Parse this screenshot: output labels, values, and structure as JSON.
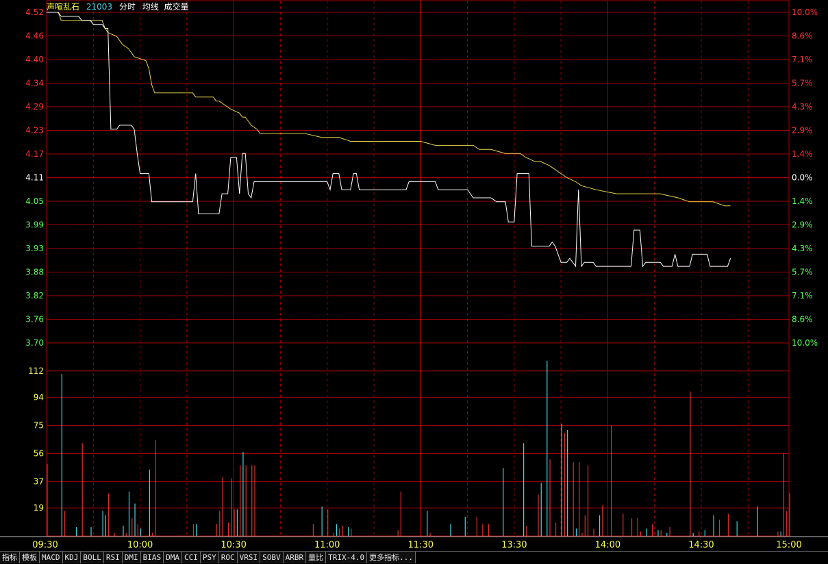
{
  "header": {
    "name": "声喧乱石",
    "code": "21003",
    "labels": [
      "分时",
      "均线",
      "成交量"
    ]
  },
  "colors": {
    "up": "#ff3232",
    "down": "#54ff54",
    "flat": "#ffffff",
    "grid": "#a00000",
    "price_line": "#ffffff",
    "avg_line": "#e8d34a",
    "vol_up": "#e03030",
    "vol_down": "#40d8e8",
    "vol_axis": "#ffff50",
    "header_name": "#ffff50",
    "header_code": "#40d8e8"
  },
  "tabs": [
    "指标",
    "模板",
    "MACD",
    "KDJ",
    "BOLL",
    "RSI",
    "DMI",
    "BIAS",
    "DMA",
    "CCI",
    "PSY",
    "ROC",
    "VRSI",
    "SOBV",
    "ARBR",
    "量比",
    "TRIX-4.0",
    "更多指标..."
  ],
  "chart_data": {
    "type": "line",
    "x_labels": [
      "09:30",
      "10:00",
      "10:30",
      "11:00",
      "11:30",
      "13:30",
      "14:00",
      "14:30",
      "15:00"
    ],
    "price_ticks": [
      "4.52",
      "4.46",
      "4.40",
      "4.34",
      "4.29",
      "4.23",
      "4.17",
      "4.11",
      "4.05",
      "3.99",
      "3.93",
      "3.88",
      "3.82",
      "3.76",
      "3.70"
    ],
    "pct_ticks": [
      "10.0%",
      "8.6%",
      "7.1%",
      "5.7%",
      "4.3%",
      "2.9%",
      "1.4%",
      "0.0%",
      "1.4%",
      "2.9%",
      "4.3%",
      "5.7%",
      "7.1%",
      "8.6%",
      "10.0%"
    ],
    "volume_ticks": [
      "112",
      "94",
      "75",
      "56",
      "37",
      "19"
    ],
    "prev_close": 4.11,
    "ylim": [
      3.7,
      4.52
    ],
    "volume_ylim": [
      0,
      131
    ],
    "price": [
      [
        0,
        4.52
      ],
      [
        4,
        4.52
      ],
      [
        5,
        4.51
      ],
      [
        11,
        4.51
      ],
      [
        12,
        4.5
      ],
      [
        15,
        4.5
      ],
      [
        16,
        4.49
      ],
      [
        19,
        4.49
      ],
      [
        20,
        4.48
      ],
      [
        21,
        4.48
      ],
      [
        22,
        4.23
      ],
      [
        24,
        4.23
      ],
      [
        25,
        4.24
      ],
      [
        29,
        4.24
      ],
      [
        30,
        4.23
      ],
      [
        31,
        4.17
      ],
      [
        32,
        4.12
      ],
      [
        35,
        4.12
      ],
      [
        36,
        4.05
      ],
      [
        50,
        4.05
      ],
      [
        51,
        4.12
      ],
      [
        52,
        4.02
      ],
      [
        59,
        4.02
      ],
      [
        60,
        4.07
      ],
      [
        62,
        4.07
      ],
      [
        63,
        4.16
      ],
      [
        65,
        4.16
      ],
      [
        66,
        4.07
      ],
      [
        67,
        4.17
      ],
      [
        68,
        4.17
      ],
      [
        69,
        4.07
      ],
      [
        70,
        4.06
      ],
      [
        71,
        4.1
      ],
      [
        96,
        4.1
      ],
      [
        97,
        4.08
      ],
      [
        98,
        4.12
      ],
      [
        100,
        4.12
      ],
      [
        101,
        4.08
      ],
      [
        104,
        4.08
      ],
      [
        105,
        4.12
      ],
      [
        106,
        4.12
      ],
      [
        107,
        4.08
      ],
      [
        123,
        4.08
      ],
      [
        124,
        4.1
      ],
      [
        133,
        4.1
      ],
      [
        134,
        4.08
      ],
      [
        144,
        4.08
      ],
      [
        146,
        4.06
      ],
      [
        152,
        4.06
      ],
      [
        154,
        4.05
      ],
      [
        157,
        4.05
      ],
      [
        158,
        4.0
      ],
      [
        160,
        4.0
      ],
      [
        161,
        4.12
      ],
      [
        165,
        4.12
      ],
      [
        166,
        3.94
      ],
      [
        172,
        3.94
      ],
      [
        173,
        3.95
      ],
      [
        174,
        3.94
      ],
      [
        176,
        3.9
      ],
      [
        178,
        3.9
      ],
      [
        179,
        3.91
      ],
      [
        180,
        3.9
      ],
      [
        181,
        3.89
      ],
      [
        182,
        4.08
      ],
      [
        183,
        3.89
      ],
      [
        184,
        3.9
      ],
      [
        187,
        3.9
      ],
      [
        188,
        3.89
      ],
      [
        200,
        3.89
      ],
      [
        201,
        3.98
      ],
      [
        203,
        3.98
      ],
      [
        204,
        3.89
      ],
      [
        205,
        3.9
      ],
      [
        210,
        3.9
      ],
      [
        211,
        3.89
      ],
      [
        214,
        3.89
      ],
      [
        215,
        3.92
      ],
      [
        216,
        3.89
      ],
      [
        220,
        3.89
      ],
      [
        221,
        3.92
      ],
      [
        226,
        3.92
      ],
      [
        227,
        3.89
      ],
      [
        233,
        3.89
      ],
      [
        234,
        3.91
      ]
    ],
    "avg": [
      [
        0,
        4.52
      ],
      [
        4,
        4.52
      ],
      [
        5,
        4.5
      ],
      [
        19,
        4.5
      ],
      [
        20,
        4.48
      ],
      [
        21,
        4.47
      ],
      [
        24,
        4.46
      ],
      [
        25,
        4.45
      ],
      [
        26,
        4.44
      ],
      [
        28,
        4.43
      ],
      [
        30,
        4.41
      ],
      [
        34,
        4.4
      ],
      [
        35,
        4.38
      ],
      [
        36,
        4.34
      ],
      [
        37,
        4.32
      ],
      [
        50,
        4.32
      ],
      [
        51,
        4.31
      ],
      [
        57,
        4.31
      ],
      [
        58,
        4.3
      ],
      [
        59,
        4.3
      ],
      [
        61,
        4.29
      ],
      [
        63,
        4.28
      ],
      [
        66,
        4.27
      ],
      [
        67,
        4.26
      ],
      [
        68,
        4.26
      ],
      [
        69,
        4.25
      ],
      [
        70,
        4.24
      ],
      [
        72,
        4.23
      ],
      [
        73,
        4.22
      ],
      [
        76,
        4.22
      ],
      [
        80,
        4.22
      ],
      [
        88,
        4.22
      ],
      [
        94,
        4.21
      ],
      [
        100,
        4.21
      ],
      [
        104,
        4.2
      ],
      [
        120,
        4.2
      ],
      [
        128,
        4.2
      ],
      [
        133,
        4.19
      ],
      [
        140,
        4.19
      ],
      [
        146,
        4.19
      ],
      [
        148,
        4.18
      ],
      [
        152,
        4.18
      ],
      [
        157,
        4.17
      ],
      [
        162,
        4.17
      ],
      [
        164,
        4.16
      ],
      [
        167,
        4.15
      ],
      [
        169,
        4.15
      ],
      [
        172,
        4.14
      ],
      [
        174,
        4.13
      ],
      [
        176,
        4.12
      ],
      [
        178,
        4.11
      ],
      [
        181,
        4.1
      ],
      [
        183,
        4.09
      ],
      [
        188,
        4.08
      ],
      [
        195,
        4.07
      ],
      [
        210,
        4.07
      ],
      [
        216,
        4.06
      ],
      [
        220,
        4.05
      ],
      [
        224,
        4.05
      ],
      [
        228,
        4.05
      ],
      [
        232,
        4.04
      ],
      [
        234,
        4.04
      ]
    ],
    "volume": [
      [
        0,
        49,
        "u"
      ],
      [
        5,
        110,
        "d"
      ],
      [
        6,
        17,
        "u"
      ],
      [
        10,
        6,
        "d"
      ],
      [
        12,
        63,
        "u"
      ],
      [
        15,
        6,
        "d"
      ],
      [
        19,
        17,
        "d"
      ],
      [
        20,
        14,
        "d"
      ],
      [
        21,
        29,
        "u"
      ],
      [
        23,
        2,
        "u"
      ],
      [
        26,
        7,
        "d"
      ],
      [
        27,
        2,
        "u"
      ],
      [
        28,
        30,
        "d"
      ],
      [
        29,
        12,
        "u"
      ],
      [
        30,
        22,
        "d"
      ],
      [
        31,
        8,
        "u"
      ],
      [
        32,
        5,
        "d"
      ],
      [
        35,
        45,
        "d"
      ],
      [
        36,
        2,
        "u"
      ],
      [
        37,
        65,
        "u"
      ],
      [
        50,
        8,
        "u"
      ],
      [
        51,
        8,
        "d"
      ],
      [
        58,
        8,
        "u"
      ],
      [
        59,
        17,
        "u"
      ],
      [
        60,
        40,
        "u"
      ],
      [
        62,
        9,
        "u"
      ],
      [
        63,
        39,
        "u"
      ],
      [
        64,
        18,
        "u"
      ],
      [
        65,
        18,
        "d"
      ],
      [
        66,
        48,
        "u"
      ],
      [
        67,
        57,
        "d"
      ],
      [
        68,
        48,
        "u"
      ],
      [
        70,
        48,
        "u"
      ],
      [
        71,
        48,
        "u"
      ],
      [
        91,
        8,
        "u"
      ],
      [
        94,
        20,
        "d"
      ],
      [
        96,
        18,
        "u"
      ],
      [
        98,
        2,
        "u"
      ],
      [
        99,
        8,
        "d"
      ],
      [
        100,
        5,
        "u"
      ],
      [
        101,
        7,
        "u"
      ],
      [
        103,
        6,
        "d"
      ],
      [
        104,
        5,
        "u"
      ],
      [
        120,
        4,
        "u"
      ],
      [
        121,
        30,
        "u"
      ],
      [
        130,
        17,
        "d"
      ],
      [
        131,
        2,
        "u"
      ],
      [
        138,
        8,
        "d"
      ],
      [
        143,
        13,
        "d"
      ],
      [
        147,
        13,
        "u"
      ],
      [
        149,
        8,
        "u"
      ],
      [
        151,
        8,
        "u"
      ],
      [
        156,
        46,
        "d"
      ],
      [
        163,
        63,
        "d"
      ],
      [
        164,
        7,
        "u"
      ],
      [
        168,
        28,
        "u"
      ],
      [
        169,
        36,
        "d"
      ],
      [
        171,
        119,
        "d"
      ],
      [
        172,
        52,
        "u"
      ],
      [
        174,
        9,
        "u"
      ],
      [
        176,
        76,
        "d"
      ],
      [
        177,
        70,
        "u"
      ],
      [
        178,
        72,
        "d"
      ],
      [
        180,
        50,
        "u"
      ],
      [
        181,
        5,
        "d"
      ],
      [
        182,
        50,
        "u"
      ],
      [
        183,
        2,
        "u"
      ],
      [
        184,
        14,
        "u"
      ],
      [
        185,
        48,
        "u"
      ],
      [
        187,
        5,
        "u"
      ],
      [
        189,
        14,
        "d"
      ],
      [
        190,
        21,
        "u"
      ],
      [
        193,
        75,
        "u"
      ],
      [
        197,
        15,
        "u"
      ],
      [
        200,
        12,
        "u"
      ],
      [
        202,
        12,
        "u"
      ],
      [
        203,
        3,
        "u"
      ],
      [
        205,
        5,
        "d"
      ],
      [
        207,
        8,
        "u"
      ],
      [
        209,
        4,
        "d"
      ],
      [
        210,
        4,
        "u"
      ],
      [
        212,
        2,
        "d"
      ],
      [
        213,
        6,
        "u"
      ],
      [
        220,
        98,
        "u"
      ],
      [
        221,
        2,
        "d"
      ],
      [
        223,
        3,
        "u"
      ],
      [
        225,
        4,
        "d"
      ],
      [
        228,
        14,
        "d"
      ],
      [
        230,
        11,
        "u"
      ],
      [
        233,
        15,
        "u"
      ],
      [
        236,
        10,
        "d"
      ],
      [
        243,
        20,
        "d"
      ],
      [
        250,
        3,
        "u"
      ],
      [
        251,
        3,
        "d"
      ],
      [
        252,
        56,
        "u"
      ],
      [
        253,
        17,
        "u"
      ],
      [
        254,
        29,
        "u"
      ]
    ]
  }
}
